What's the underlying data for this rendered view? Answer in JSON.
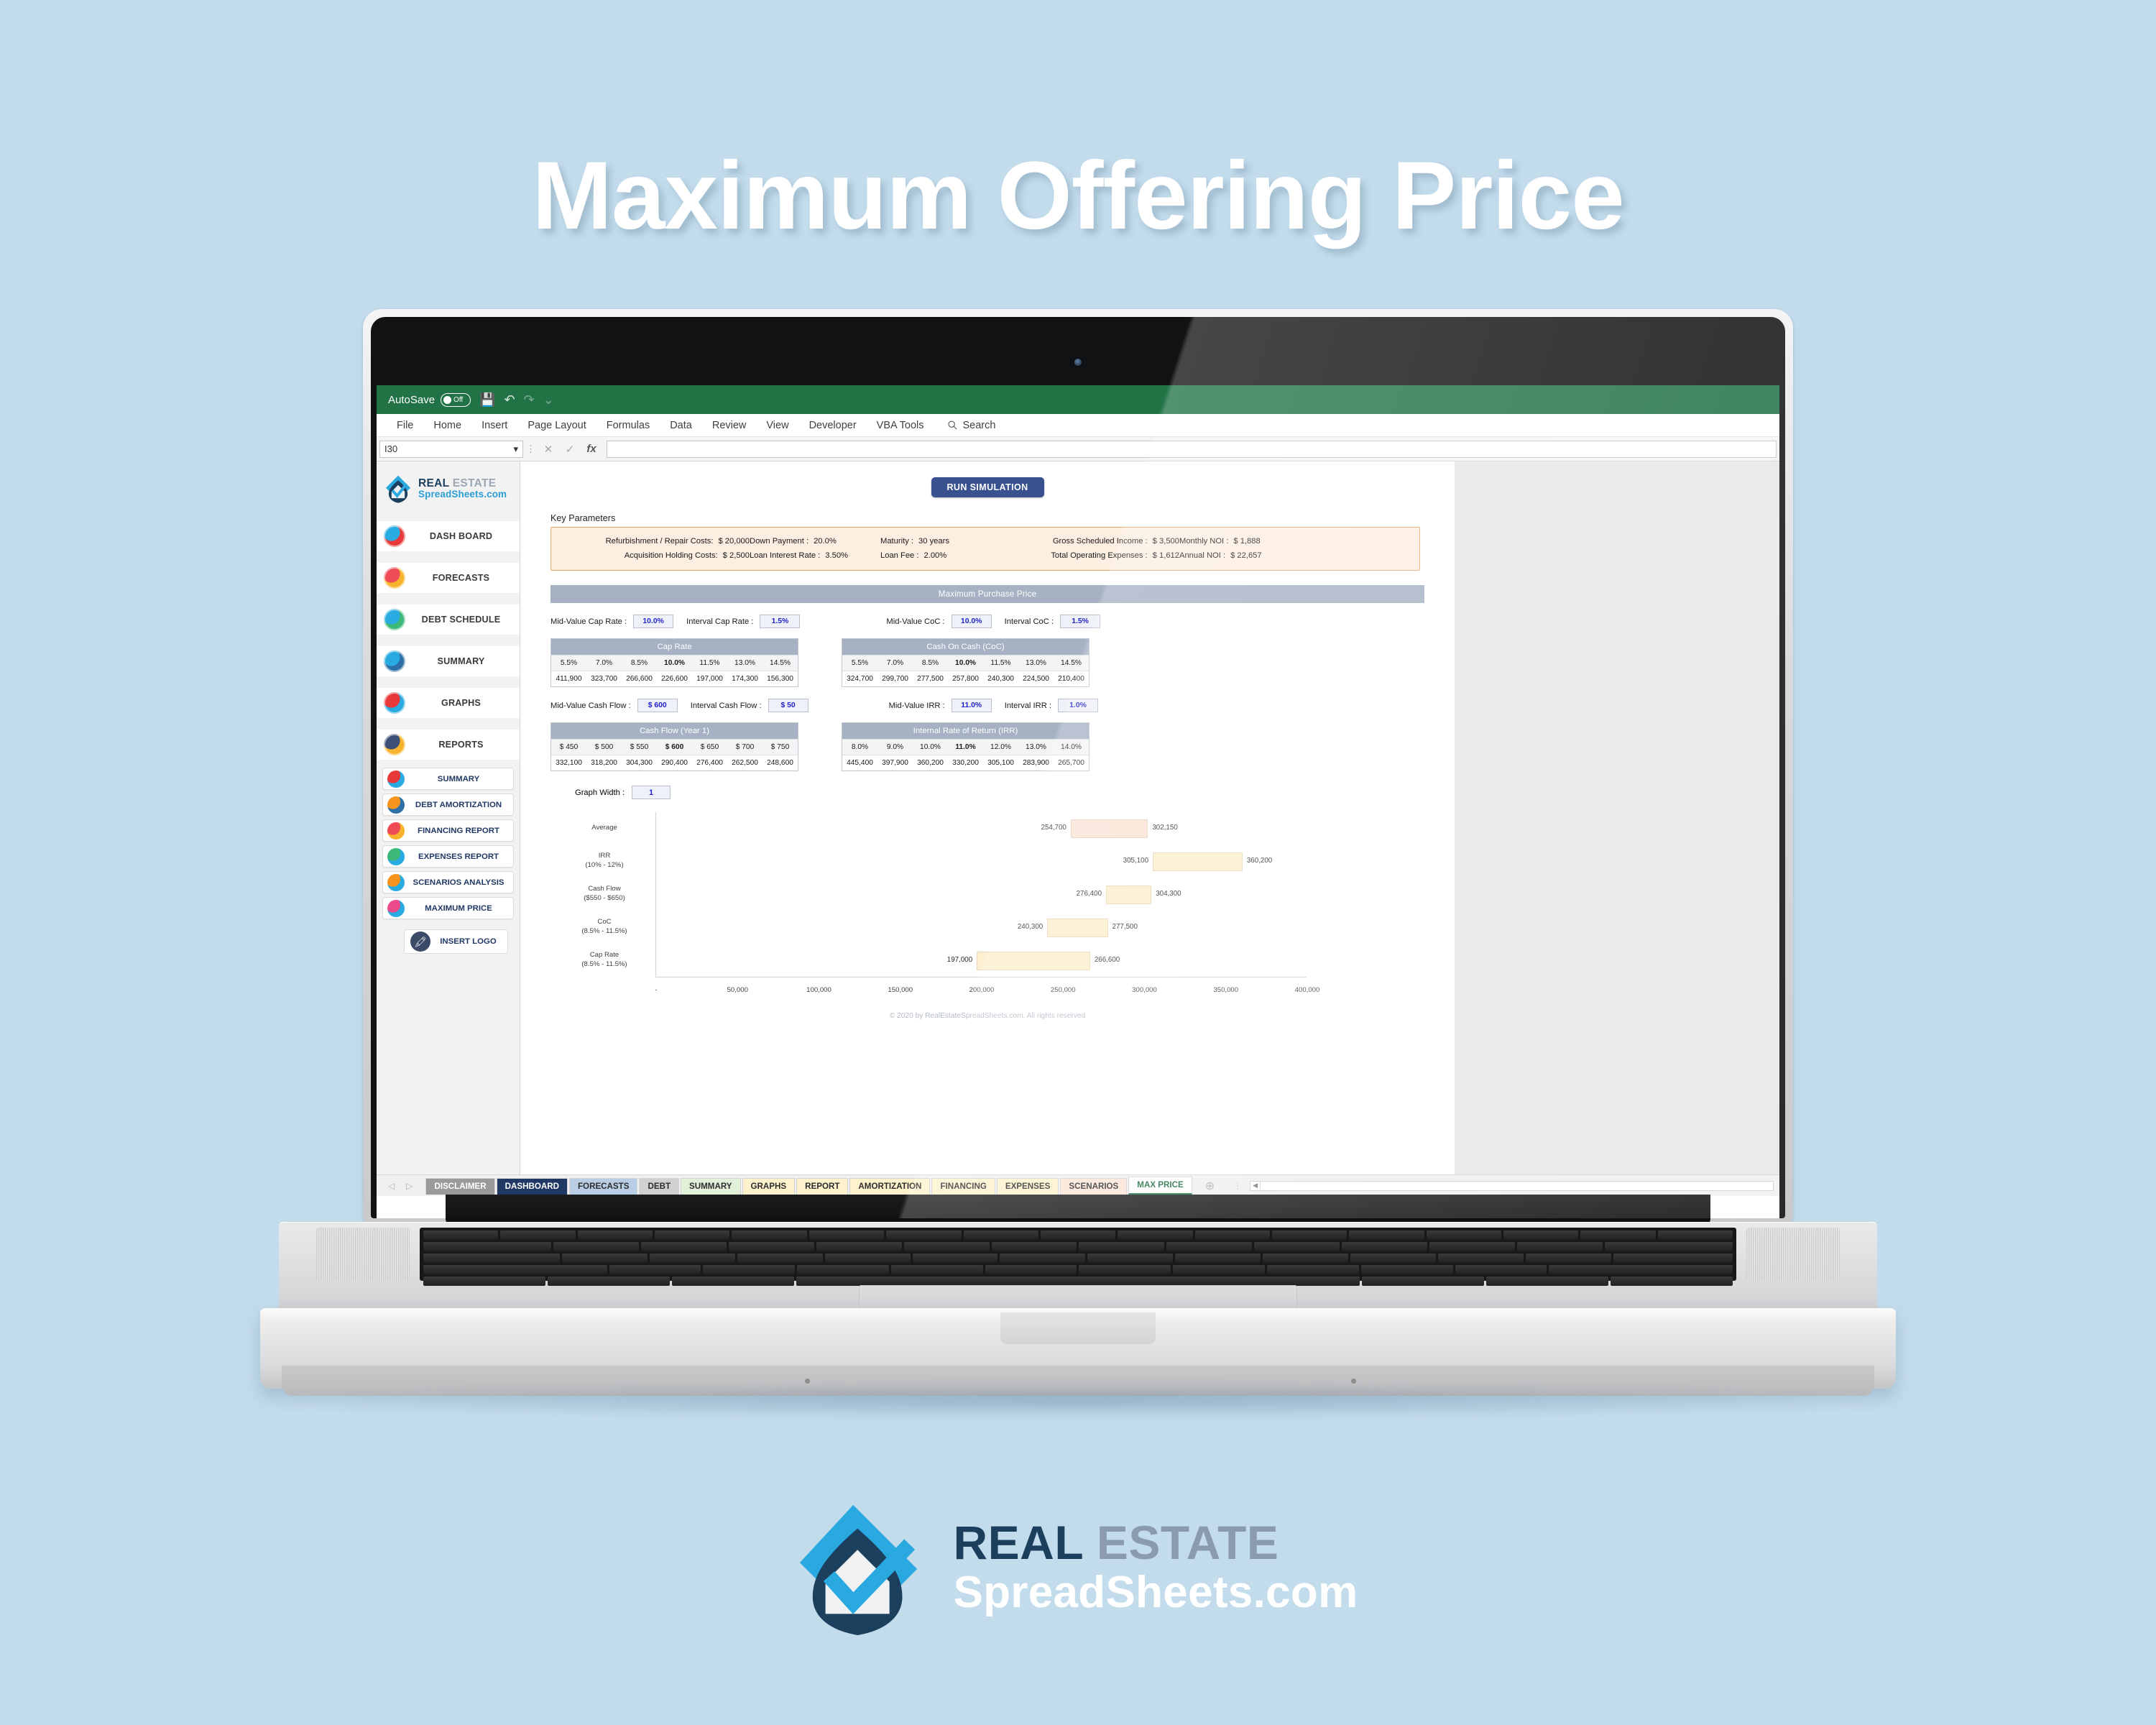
{
  "hero": {
    "title": "Maximum Offering Price"
  },
  "excel": {
    "autosave_label": "AutoSave",
    "autosave_state": "Off",
    "quick_access": [
      "save-icon",
      "undo-icon",
      "redo-icon",
      "customize-qat-icon"
    ],
    "ribbon_tabs": [
      "File",
      "Home",
      "Insert",
      "Page Layout",
      "Formulas",
      "Data",
      "Review",
      "View",
      "Developer",
      "VBA Tools"
    ],
    "search_label": "Search",
    "name_box_value": "I30",
    "formula_buttons": [
      "✕",
      "✓",
      "fx"
    ],
    "formula_value": ""
  },
  "sidebar": {
    "brand": {
      "line1_dark": "REAL",
      "line1_grey": "ESTATE",
      "line2": "SpreadSheets.com"
    },
    "primary_items": [
      {
        "label": "DASH BOARD",
        "icon": "dashboard-house-icon",
        "c1": "#29aae1",
        "c2": "#e8393b"
      },
      {
        "label": "FORECASTS",
        "icon": "forecast-chart-icon",
        "c1": "#ef4b57",
        "c2": "#f7b32b"
      },
      {
        "label": "DEBT SCHEDULE",
        "icon": "calendar-check-icon",
        "c1": "#29aae1",
        "c2": "#3cb878"
      },
      {
        "label": "SUMMARY",
        "icon": "monitor-report-icon",
        "c1": "#29aae1",
        "c2": "#2e6fa7"
      },
      {
        "label": "GRAPHS",
        "icon": "analytics-search-icon",
        "c1": "#e8393b",
        "c2": "#29aae1"
      },
      {
        "label": "REPORTS",
        "icon": "report-clipboard-icon",
        "c1": "#3c4f76",
        "c2": "#f7b32b"
      }
    ],
    "secondary_items": [
      {
        "label": "SUMMARY",
        "icon": "summary-doc-icon",
        "c1": "#e8393b",
        "c2": "#29aae1"
      },
      {
        "label": "DEBT AMORTIZATION",
        "icon": "amortization-icon",
        "c1": "#f7941e",
        "c2": "#2e6fa7"
      },
      {
        "label": "FINANCING REPORT",
        "icon": "financing-icon",
        "c1": "#ef4b57",
        "c2": "#f7b32b"
      },
      {
        "label": "EXPENSES REPORT",
        "icon": "expenses-gauge-icon",
        "c1": "#3cb878",
        "c2": "#29aae1"
      },
      {
        "label": "SCENARIOS ANALYSIS",
        "icon": "scenarios-calculator-icon",
        "c1": "#f7941e",
        "c2": "#29aae1"
      },
      {
        "label": "MAXIMUM PRICE",
        "icon": "maximum-price-idea-icon",
        "c1": "#ec4a8b",
        "c2": "#29aae1"
      }
    ],
    "insert_logo_label": "INSERT LOGO"
  },
  "sheet": {
    "run_simulation_label": "RUN SIMULATION",
    "key_parameters_title": "Key Parameters",
    "key_parameters": [
      [
        {
          "label": "Refurbishment / Repair Costs:",
          "value": "$ 20,000"
        },
        {
          "label": "Down Payment :",
          "value": "20.0%"
        },
        {
          "label": "Maturity :",
          "value": "30 years"
        },
        {
          "label": "Gross Scheduled Income :",
          "value": "$ 3,500"
        },
        {
          "label": "Monthly NOI :",
          "value": "$ 1,888"
        }
      ],
      [
        {
          "label": "Acquisition Holding Costs:",
          "value": "$ 2,500"
        },
        {
          "label": "Loan Interest Rate :",
          "value": "3.50%"
        },
        {
          "label": "Loan Fee :",
          "value": "2.00%"
        },
        {
          "label": "Total Operating Expenses :",
          "value": "$ 1,612"
        },
        {
          "label": "Annual NOI :",
          "value": "$ 22,657"
        }
      ]
    ],
    "max_purchase_price_banner": "Maximum Purchase Price",
    "inputs_row1": [
      {
        "label": "Mid-Value Cap Rate :",
        "value": "10.0%",
        "name": "mid-value-cap-rate-input"
      },
      {
        "label": "Interval Cap Rate :",
        "value": "1.5%",
        "name": "interval-cap-rate-input"
      },
      {
        "label": "Mid-Value CoC :",
        "value": "10.0%",
        "name": "mid-value-coc-input"
      },
      {
        "label": "Interval CoC :",
        "value": "1.5%",
        "name": "interval-coc-input"
      }
    ],
    "inputs_row2": [
      {
        "label": "Mid-Value Cash Flow :",
        "value": "$ 600",
        "name": "mid-value-cash-flow-input"
      },
      {
        "label": "Interval Cash Flow :",
        "value": "$ 50",
        "name": "interval-cash-flow-input"
      },
      {
        "label": "Mid-Value IRR :",
        "value": "11.0%",
        "name": "mid-value-irr-input"
      },
      {
        "label": "Interval IRR :",
        "value": "1.0%",
        "name": "interval-irr-input"
      }
    ],
    "graph_width_label": "Graph Width :",
    "graph_width_value": "1",
    "footer": "© 2020 by RealEstateSpreadSheets.com. All rights reserved"
  },
  "tables": [
    {
      "title": "Cap Rate",
      "headers": [
        "5.5%",
        "7.0%",
        "8.5%",
        "10.0%",
        "11.5%",
        "13.0%",
        "14.5%"
      ],
      "values": [
        "411,900",
        "323,700",
        "266,600",
        "226,600",
        "197,000",
        "174,300",
        "156,300"
      ],
      "bold_index": 3
    },
    {
      "title": "Cash On Cash (CoC)",
      "headers": [
        "5.5%",
        "7.0%",
        "8.5%",
        "10.0%",
        "11.5%",
        "13.0%",
        "14.5%"
      ],
      "values": [
        "324,700",
        "299,700",
        "277,500",
        "257,800",
        "240,300",
        "224,500",
        "210,400"
      ],
      "bold_index": 3
    },
    {
      "title": "Cash Flow (Year 1)",
      "headers": [
        "$ 450",
        "$ 500",
        "$ 550",
        "$ 600",
        "$ 650",
        "$ 700",
        "$ 750"
      ],
      "values": [
        "332,100",
        "318,200",
        "304,300",
        "290,400",
        "276,400",
        "262,500",
        "248,600"
      ],
      "bold_index": 3
    },
    {
      "title": "Internal Rate of Return (IRR)",
      "headers": [
        "8.0%",
        "9.0%",
        "10.0%",
        "11.0%",
        "12.0%",
        "13.0%",
        "14.0%"
      ],
      "values": [
        "445,400",
        "397,900",
        "360,200",
        "330,200",
        "305,100",
        "283,900",
        "265,700"
      ],
      "bold_index": 3
    }
  ],
  "chart_data": {
    "type": "bar",
    "orientation": "horizontal",
    "subtype": "range-bar",
    "title": "",
    "xlabel": "",
    "ylabel": "",
    "xlim": [
      0,
      400000
    ],
    "xticks": [
      "-",
      "50,000",
      "100,000",
      "150,000",
      "200,000",
      "250,000",
      "300,000",
      "350,000",
      "400,000"
    ],
    "xtick_values": [
      0,
      50000,
      100000,
      150000,
      200000,
      250000,
      300000,
      350000,
      400000
    ],
    "grid": false,
    "legend": "none",
    "categories": [
      "Average",
      "IRR\n(10% - 12%)",
      "Cash Flow\n($550 - $650)",
      "CoC\n(8.5% - 11.5%)",
      "Cap Rate\n(8.5% - 11.5%)"
    ],
    "bars": [
      {
        "label_line1": "Average",
        "label_line2": "",
        "low": 254700,
        "high": 302150,
        "low_text": "254,700",
        "high_text": "302,150",
        "color": "#fbe3d6"
      },
      {
        "label_line1": "IRR",
        "label_line2": "(10% - 12%)",
        "low": 305100,
        "high": 360200,
        "low_text": "305,100",
        "high_text": "360,200",
        "color": "#fdeecd"
      },
      {
        "label_line1": "Cash Flow",
        "label_line2": "($550 - $650)",
        "low": 276400,
        "high": 304300,
        "low_text": "276,400",
        "high_text": "304,300",
        "color": "#fdeecd"
      },
      {
        "label_line1": "CoC",
        "label_line2": "(8.5% - 11.5%)",
        "low": 240300,
        "high": 277500,
        "low_text": "240,300",
        "high_text": "277,500",
        "color": "#fdeecd"
      },
      {
        "label_line1": "Cap Rate",
        "label_line2": "(8.5% - 11.5%)",
        "low": 197000,
        "high": 266600,
        "low_text": "197,000",
        "high_text": "266,600",
        "color": "#fdeecd"
      }
    ]
  },
  "sheet_tabs": [
    {
      "label": "DISCLAIMER",
      "style": "disclaimer",
      "active": false
    },
    {
      "label": "DASHBOARD",
      "style": "dashboard",
      "active": false
    },
    {
      "label": "FORECASTS",
      "style": "forecasts",
      "active": false
    },
    {
      "label": "DEBT",
      "style": "debt",
      "active": false
    },
    {
      "label": "SUMMARY",
      "style": "summary",
      "active": false
    },
    {
      "label": "GRAPHS",
      "style": "yellow",
      "active": false
    },
    {
      "label": "REPORT",
      "style": "yellow",
      "active": false
    },
    {
      "label": "AMORTIZATION",
      "style": "yellow",
      "active": false
    },
    {
      "label": "FINANCING",
      "style": "yellow",
      "active": false
    },
    {
      "label": "EXPENSES",
      "style": "yellow",
      "active": false
    },
    {
      "label": "SCENARIOS",
      "style": "scenarios",
      "active": false
    },
    {
      "label": "MAX PRICE",
      "style": "active",
      "active": true
    }
  ],
  "bottom_logo": {
    "line1_dark": "REAL",
    "line1_grey": "ESTATE",
    "line2": "SpreadSheets.com"
  },
  "colors": {
    "page_bg": "#c3dcec",
    "excel_green": "#217346",
    "banner_blue_grey": "#a6b2c4",
    "key_param_bg": "#fdeee2",
    "key_param_border": "#e8a96a",
    "input_text": "#2222cc",
    "run_button": "#3a5190",
    "bar_cream": "#fdeecd",
    "bar_peach": "#fbe3d6"
  }
}
